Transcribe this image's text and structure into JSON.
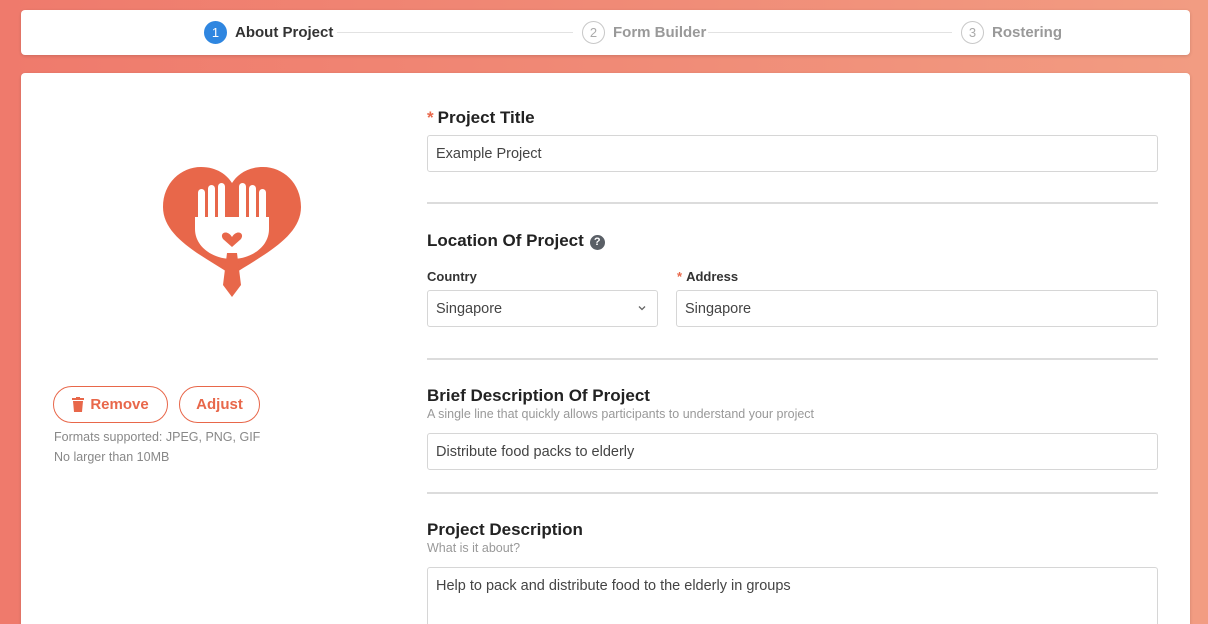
{
  "stepper": {
    "steps": [
      {
        "num": "1",
        "label": "About Project"
      },
      {
        "num": "2",
        "label": "Form Builder"
      },
      {
        "num": "3",
        "label": "Rostering"
      }
    ]
  },
  "image_panel": {
    "remove_label": "Remove",
    "adjust_label": "Adjust",
    "formats_hint": "Formats supported: JPEG, PNG, GIF",
    "size_hint": "No larger than 10MB"
  },
  "form": {
    "project_title": {
      "required_mark": "*",
      "label": "Project Title",
      "value": "Example Project"
    },
    "location": {
      "label": "Location Of Project",
      "help_icon": "?",
      "country_label": "Country",
      "country_value": "Singapore",
      "address_required_mark": "*",
      "address_label": "Address",
      "address_value": "Singapore"
    },
    "brief": {
      "label": "Brief Description Of Project",
      "hint": "A single line that quickly allows participants to understand your project",
      "value": "Distribute food packs to elderly"
    },
    "description": {
      "label": "Project Description",
      "hint": "What is it about?",
      "value": "Help to pack and distribute food to the elderly in groups"
    }
  },
  "colors": {
    "accent": "#e8674a",
    "step_active": "#2f86e0"
  }
}
